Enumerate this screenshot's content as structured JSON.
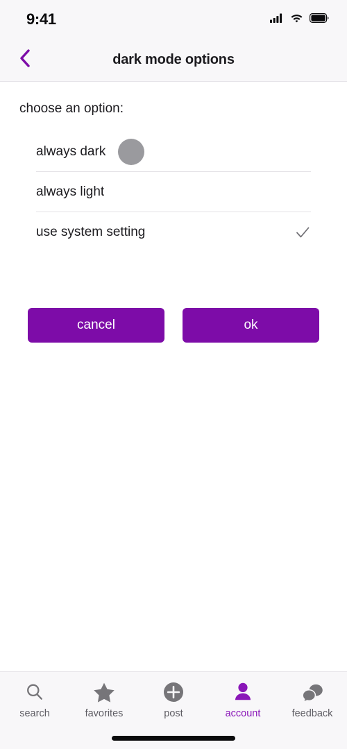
{
  "status_bar": {
    "time": "9:41",
    "icons": [
      "cellular-signal-icon",
      "wifi-icon",
      "battery-icon"
    ]
  },
  "header": {
    "title": "dark mode options",
    "back_icon": "chevron-left-icon",
    "accent_color": "#7d0ca8"
  },
  "main": {
    "section_label": "choose an option:",
    "options": [
      {
        "label": "always dark",
        "swatch_color": "#9a9a9e",
        "selected": false,
        "has_swatch": true
      },
      {
        "label": "always light",
        "selected": false,
        "has_swatch": false
      },
      {
        "label": "use system setting",
        "selected": true,
        "has_swatch": false
      }
    ],
    "check_icon": "check-icon",
    "check_color": "#6f6e73"
  },
  "actions": {
    "cancel_label": "cancel",
    "ok_label": "ok",
    "button_color": "#7d0ca8"
  },
  "tab_bar": {
    "active_color": "#8a16b8",
    "inactive_color": "#767579",
    "items": [
      {
        "label": "search",
        "icon": "search-icon",
        "active": false
      },
      {
        "label": "favorites",
        "icon": "star-icon",
        "active": false
      },
      {
        "label": "post",
        "icon": "plus-circle-icon",
        "active": false
      },
      {
        "label": "account",
        "icon": "person-icon",
        "active": true
      },
      {
        "label": "feedback",
        "icon": "chat-bubbles-icon",
        "active": false
      }
    ]
  }
}
